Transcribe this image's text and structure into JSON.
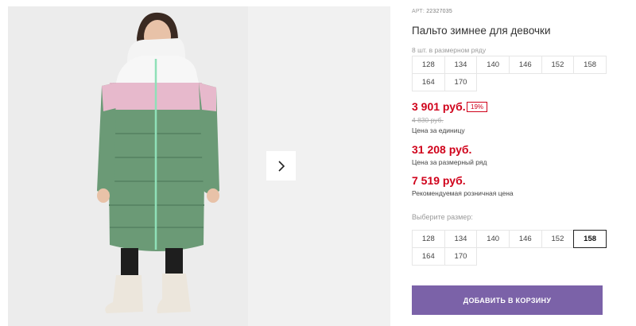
{
  "product": {
    "article_prefix": "АРТ:",
    "article_number": "22327035",
    "title": "Пальто зимнее для девочки"
  },
  "pack": {
    "label": "8 шт. в размерном ряду",
    "sizes": [
      "128",
      "134",
      "140",
      "146",
      "152",
      "158",
      "164",
      "170"
    ]
  },
  "prices": {
    "unit_price": "3 901 руб.",
    "discount_badge": "19%",
    "old_price": "4 830 руб.",
    "unit_caption": "Цена за единицу",
    "pack_price": "31 208 руб.",
    "pack_caption": "Цена за размерный ряд",
    "rrp_price": "7 519 руб.",
    "rrp_caption": "Рекомендуемая розничная цена"
  },
  "size_select": {
    "label": "Выберите размер:",
    "sizes": [
      "128",
      "134",
      "140",
      "146",
      "152",
      "158",
      "164",
      "170"
    ],
    "selected": "158"
  },
  "cart": {
    "add_label": "ДОБАВИТЬ В КОРЗИНУ"
  },
  "gallery": {
    "next_icon": "chevron-right-icon"
  },
  "colors": {
    "price_red": "#d0021b",
    "button_purple": "#7b62a8",
    "coat_green": "#6b9a76",
    "coat_pink": "#e7b9cc"
  }
}
